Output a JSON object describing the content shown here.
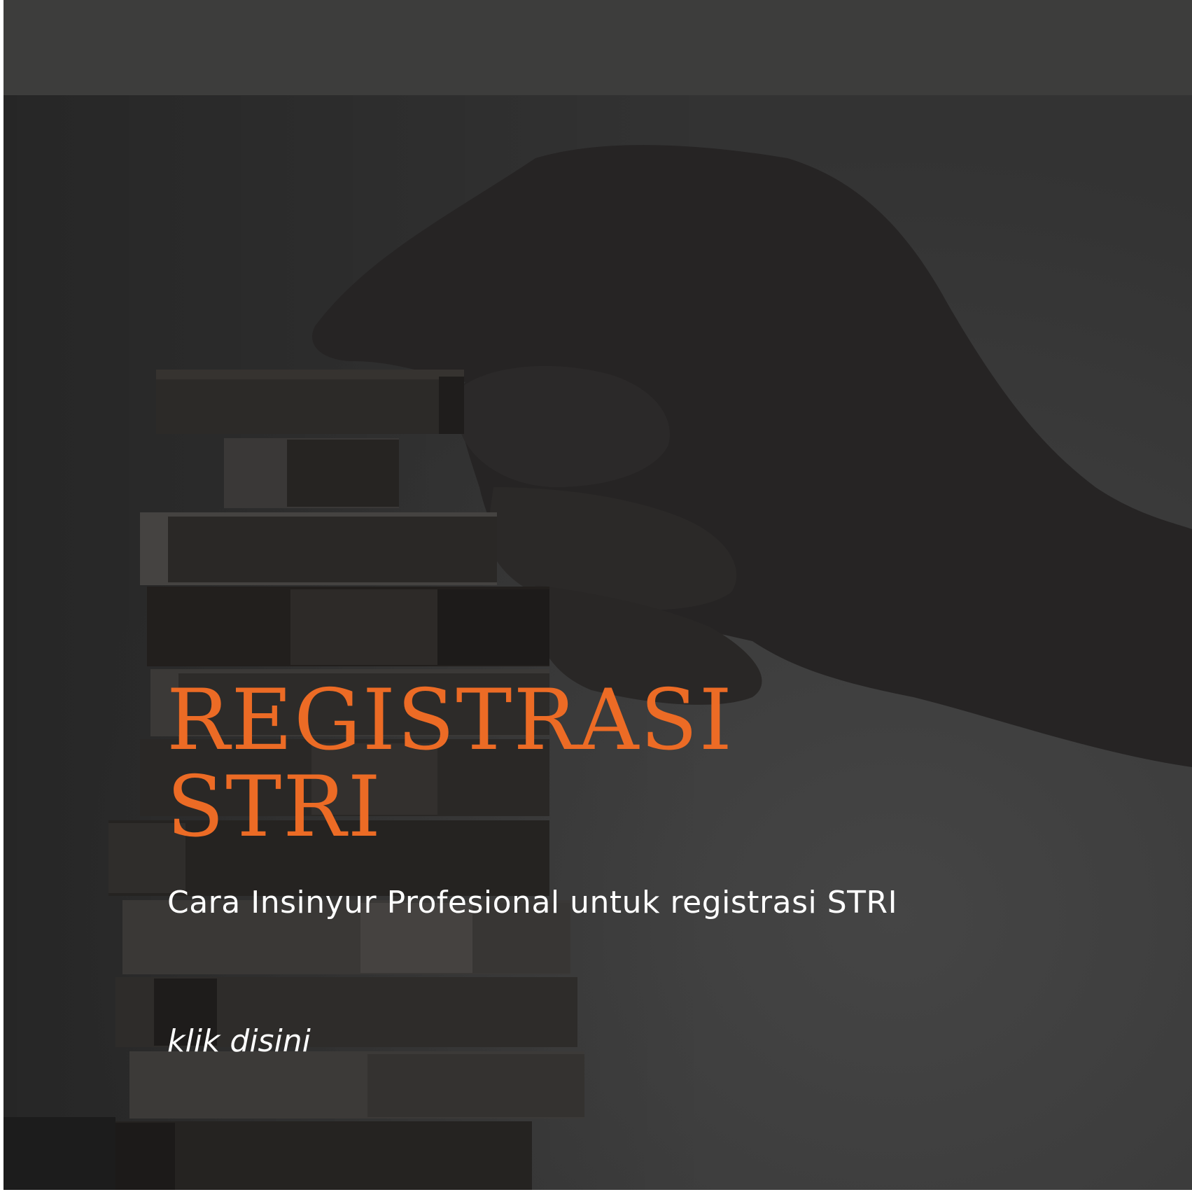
{
  "banner": {
    "title_line_1": "REGISTRASI",
    "title_line_2": "STRI",
    "subtitle": "Cara Insinyur Profesional untuk registrasi STRI",
    "cta_label": "klik disini"
  },
  "colors": {
    "background": "#3a3a3a",
    "title": "#ec6b25",
    "text": "#ffffff"
  }
}
